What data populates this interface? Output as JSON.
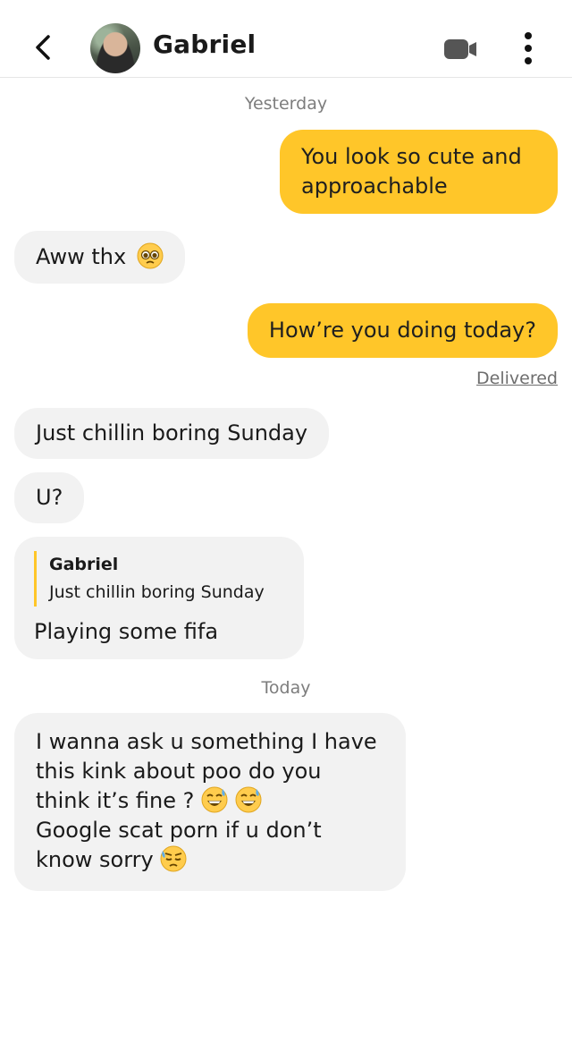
{
  "header": {
    "contact_name": "Gabriel",
    "back_icon": "chevron-left-icon",
    "video_icon": "video-camera-icon",
    "more_icon": "more-vertical-icon"
  },
  "colors": {
    "accent": "#ffc629",
    "incoming_bubble": "#f2f2f2",
    "divider": "#e6e6e6"
  },
  "dates": {
    "yesterday": "Yesterday",
    "today": "Today"
  },
  "messages": [
    {
      "from": "me",
      "text": "You look so cute and approachable"
    },
    {
      "from": "them",
      "text": "Aww thx",
      "emoji": "pleading-face"
    },
    {
      "from": "me",
      "text": "How’re you doing today?"
    },
    {
      "from": "them",
      "text": "Just chillin boring Sunday"
    },
    {
      "from": "them",
      "text": "U?"
    },
    {
      "from": "them",
      "quote_name": "Gabriel",
      "quote_text": "Just chillin boring Sunday",
      "text": "Playing some fifa"
    },
    {
      "from": "them",
      "lines": [
        "I wanna ask u something I have",
        "this kink about poo do you",
        "think it’s fine ?",
        "Google scat porn if u don’t",
        "know sorry"
      ],
      "emojis": [
        "grinning-sweat",
        "grinning-sweat",
        "downcast-sweat"
      ]
    }
  ],
  "status": {
    "delivered": "Delivered"
  }
}
